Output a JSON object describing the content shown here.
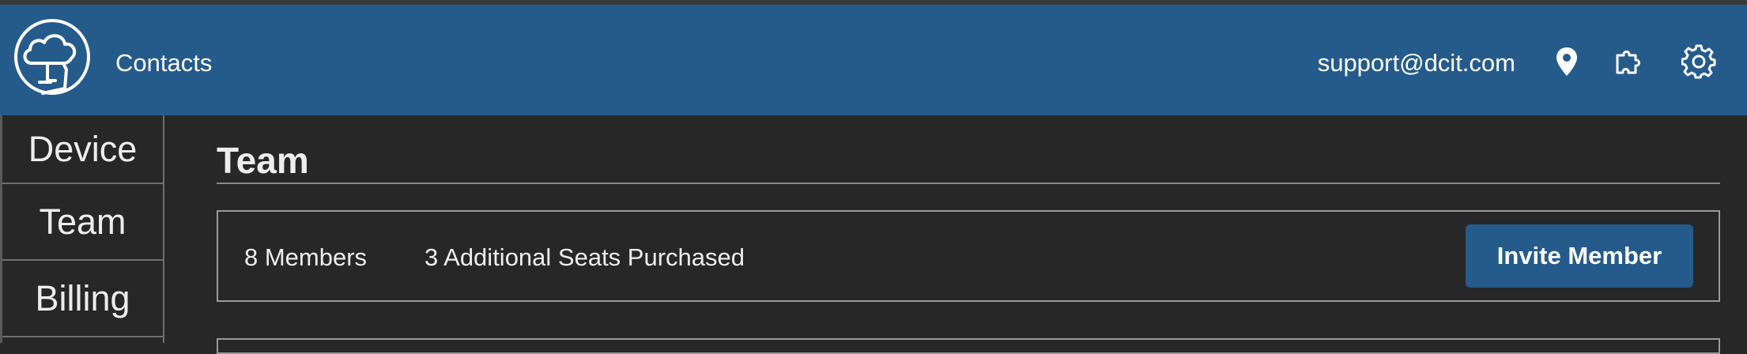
{
  "header": {
    "app_title": "Contacts",
    "email": "support@dcit.com",
    "icons": [
      "location-pin-icon",
      "puzzle-icon",
      "gear-icon"
    ],
    "background_color": "#255b8b"
  },
  "sidebar": {
    "items": [
      {
        "label": "Device"
      },
      {
        "label": "Team"
      },
      {
        "label": "Billing"
      }
    ]
  },
  "main": {
    "title": "Team",
    "summary": {
      "members": "8 Members",
      "seats": "3 Additional Seats Purchased",
      "invite_label": "Invite Member"
    }
  },
  "colors": {
    "accent": "#255b8b",
    "background": "#272727",
    "border": "#9a9a9a"
  }
}
